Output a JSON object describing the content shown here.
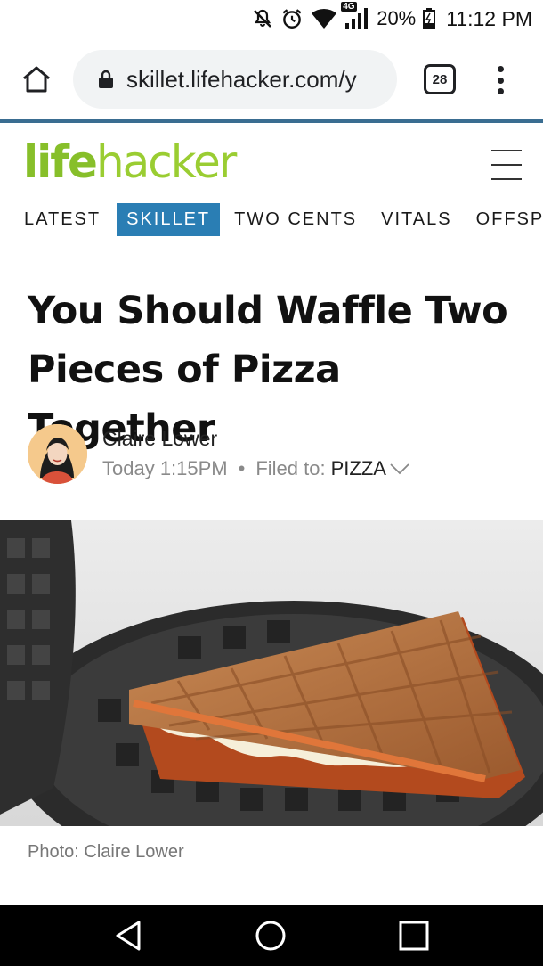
{
  "status_bar": {
    "battery": "20%",
    "time": "11:12 PM",
    "network_badge": "4G",
    "icons": [
      "mute-icon",
      "alarm-icon",
      "wifi-icon",
      "signal-icon",
      "battery-icon"
    ]
  },
  "browser": {
    "url": "skillet.lifehacker.com/y",
    "tab_count": "28",
    "icons": [
      "home-icon",
      "lock-icon",
      "tabs-icon",
      "menu-icon"
    ]
  },
  "site": {
    "logo": "lifehacker",
    "nav": [
      "LATEST",
      "SKILLET",
      "TWO CENTS",
      "VITALS",
      "OFFSPRIN"
    ],
    "active_nav": "SKILLET",
    "colors": {
      "logo": "#87bf2a",
      "active_tab": "#2a7eb4",
      "divider": "#3a6d91"
    }
  },
  "article": {
    "title": "You Should Waffle Two Pieces of Pizza Together",
    "author": "Claire Lower",
    "date": "Today 1:15PM",
    "filed_label": "Filed to:",
    "category": "PIZZA",
    "photo_caption": "Photo: Claire Lower"
  }
}
